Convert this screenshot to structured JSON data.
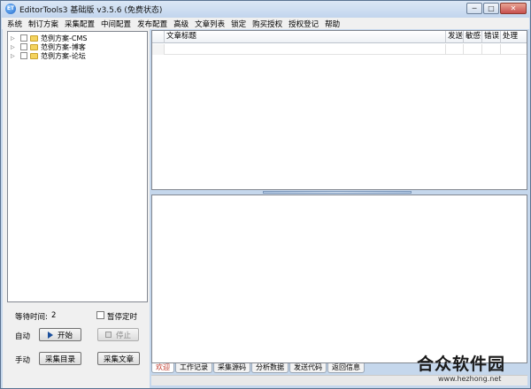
{
  "window": {
    "title": "EditorTools3 基础版 v3.5.6 (免费状态)",
    "app_icon_text": "ET",
    "buttons": {
      "minimize": "─",
      "maximize": "□",
      "close": "✕"
    }
  },
  "menu": [
    {
      "label": "系统"
    },
    {
      "label": "制订方案"
    },
    {
      "label": "采集配置"
    },
    {
      "label": "中间配置"
    },
    {
      "label": "发布配置"
    },
    {
      "label": "高级"
    },
    {
      "label": "文章列表"
    },
    {
      "label": "锁定"
    },
    {
      "label": "购买授权"
    },
    {
      "label": "授权登记"
    },
    {
      "label": "帮助"
    }
  ],
  "tree": {
    "items": [
      {
        "label": "范例方案-CMS",
        "expander": "▷"
      },
      {
        "label": "范例方案-博客",
        "expander": "▷"
      },
      {
        "label": "范例方案-论坛",
        "expander": "▷"
      }
    ]
  },
  "controls": {
    "wait_label": "等待时间:",
    "wait_value": "2",
    "pause_timer_label": "暂停定时",
    "auto_label": "自动",
    "start_button": "开始",
    "stop_button": "停止",
    "manual_label": "手动",
    "collect_list_button": "采集目录",
    "collect_article_button": "采集文章"
  },
  "grid": {
    "columns": [
      "文章标题",
      "发送",
      "敏感",
      "错误",
      "处理"
    ]
  },
  "tabs": [
    {
      "label": "欢迎",
      "active": true
    },
    {
      "label": "工作记录",
      "active": false
    },
    {
      "label": "采集源码",
      "active": false
    },
    {
      "label": "分析数据",
      "active": false
    },
    {
      "label": "发送代码",
      "active": false
    },
    {
      "label": "返回信息",
      "active": false
    }
  ],
  "watermark": {
    "main": "合众软件园",
    "url": "www.hezhong.net"
  }
}
